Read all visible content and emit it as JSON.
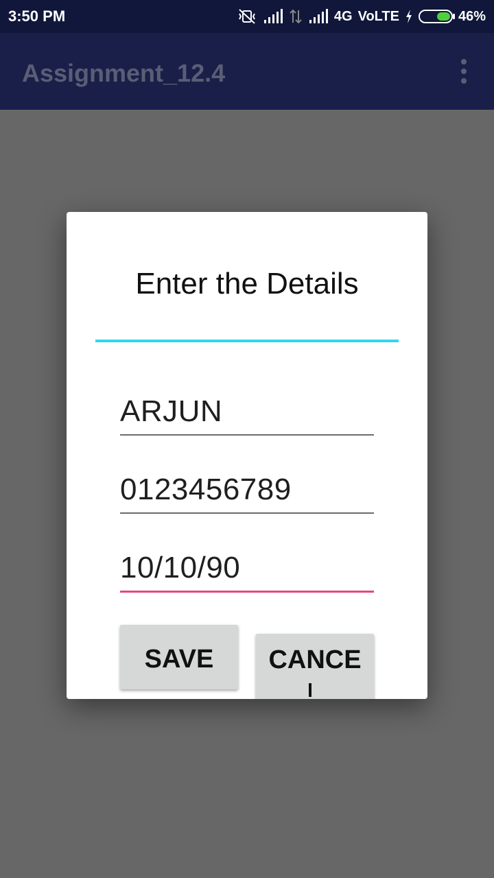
{
  "status_bar": {
    "time": "3:50 PM",
    "network": "4G",
    "volte": "VoLTE",
    "battery": "46%",
    "icons": [
      "vibrate-off-icon",
      "signal-icon",
      "data-arrows-icon",
      "signal-icon",
      "charging-icon",
      "battery-icon"
    ]
  },
  "app_bar": {
    "title": "Assignment_12.4",
    "menu_icon": "overflow-menu-icon"
  },
  "dialog": {
    "title": "Enter the Details",
    "fields": [
      {
        "value": "ARJUN"
      },
      {
        "value": "0123456789"
      },
      {
        "value": "10/10/90"
      }
    ],
    "save_label": "SAVE",
    "cancel_label": "CANCE"
  },
  "colors": {
    "status_bar": "#11173a",
    "app_bar": "#1a1f4a",
    "divider_accent": "#33d6f2",
    "focused_underline": "#e8467a",
    "button_bg": "#d6d7d7"
  }
}
